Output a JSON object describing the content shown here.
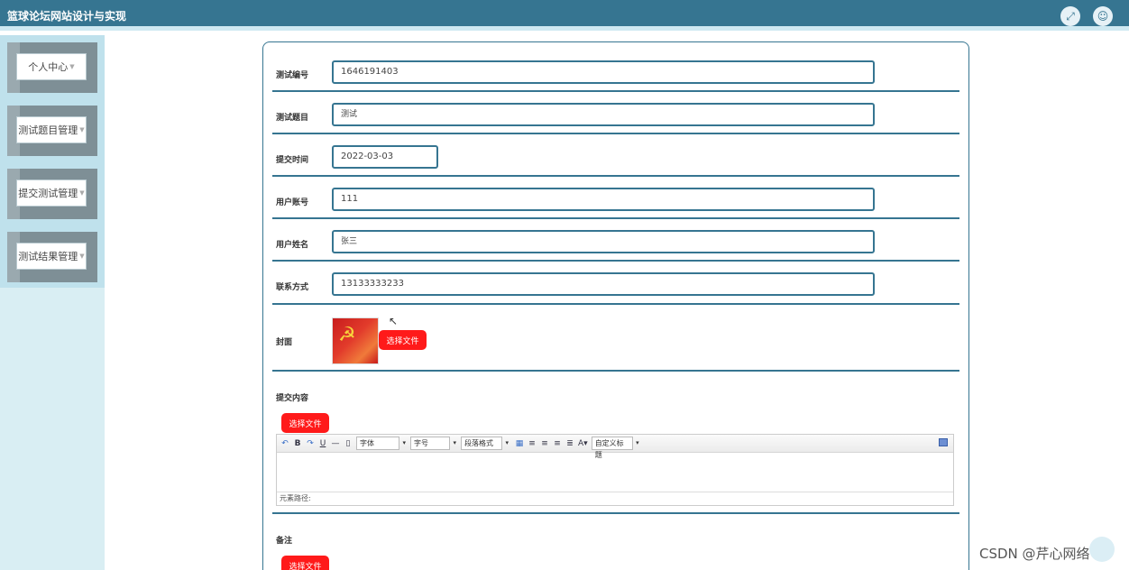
{
  "header": {
    "title": "篮球论坛网站设计与实现",
    "fullscreen_icon": "expand-icon",
    "user_icon": "user-icon"
  },
  "sidebar": {
    "items": [
      {
        "label": "个人中心"
      },
      {
        "label": "测试题目管理"
      },
      {
        "label": "提交测试管理"
      },
      {
        "label": "测试结果管理"
      }
    ]
  },
  "form": {
    "test_no": {
      "label": "测试编号",
      "value": "1646191403"
    },
    "test_title": {
      "label": "测试题目",
      "value": "测试"
    },
    "submit_time": {
      "label": "提交时间",
      "value": "2022-03-03"
    },
    "user_account": {
      "label": "用户账号",
      "value": "111"
    },
    "user_name": {
      "label": "用户姓名",
      "value": "张三"
    },
    "contact": {
      "label": "联系方式",
      "value": "13133333233"
    },
    "cover": {
      "label": "封面",
      "button": "选择文件"
    },
    "content": {
      "label": "提交内容",
      "button": "选择文件"
    },
    "note": {
      "label": "备注",
      "button": "选择文件"
    }
  },
  "editor": {
    "font_select": "字体",
    "size_select": "字号",
    "paragraph_select": "段落格式",
    "custom_title_select": "自定义标题",
    "footer": "元素路径:"
  },
  "watermark": "CSDN @芹心网络"
}
